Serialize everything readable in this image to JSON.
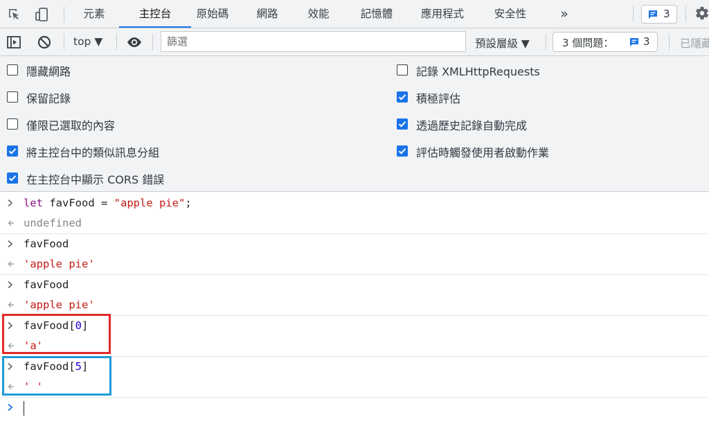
{
  "tabs": [
    {
      "label": "元素"
    },
    {
      "label": "主控台"
    },
    {
      "label": "原始碼"
    },
    {
      "label": "網路"
    },
    {
      "label": "效能"
    },
    {
      "label": "記憶體"
    },
    {
      "label": "應用程式"
    },
    {
      "label": "安全性"
    }
  ],
  "more_tabs_glyph": "»",
  "active_tab": "主控台",
  "issues_badge_count": "3",
  "toolbar": {
    "context": "top ▼",
    "filter_placeholder": "篩選",
    "levels": "預設層級 ▼",
    "issues_label": "3 個問題：",
    "issues_count": "3",
    "hidden_label": "已隱藏"
  },
  "settings": {
    "left": [
      {
        "label": "隱藏網路",
        "checked": false
      },
      {
        "label": "保留記錄",
        "checked": false
      },
      {
        "label": "僅限已選取的內容",
        "checked": false
      },
      {
        "label": "將主控台中的類似訊息分組",
        "checked": true
      },
      {
        "label": "在主控台中顯示 CORS 錯誤",
        "checked": true
      }
    ],
    "right": [
      {
        "label": "記錄 XMLHttpRequests",
        "checked": false
      },
      {
        "label": "積極評估",
        "checked": true
      },
      {
        "label": "透過歷史記錄自動完成",
        "checked": true
      },
      {
        "label": "評估時觸發使用者啟動作業",
        "checked": true
      }
    ]
  },
  "console": {
    "m1": {
      "keyword": "let",
      "ident": " favFood = ",
      "string": "\"apple pie\"",
      "tail": ";",
      "result": "undefined"
    },
    "m2": {
      "input": "favFood",
      "result": "'apple pie'"
    },
    "m3": {
      "input": "favFood",
      "result": "'apple pie'"
    },
    "m4": {
      "input_pre": "favFood[",
      "index": "0",
      "input_post": "]",
      "result": "'a'"
    },
    "m5": {
      "input_pre": "favFood[",
      "index": "5",
      "input_post": "]",
      "result": "' '"
    }
  },
  "colors": {
    "accent": "#1a73e8",
    "highlight_red": "#e22828",
    "highlight_blue": "#1e9ad6"
  }
}
